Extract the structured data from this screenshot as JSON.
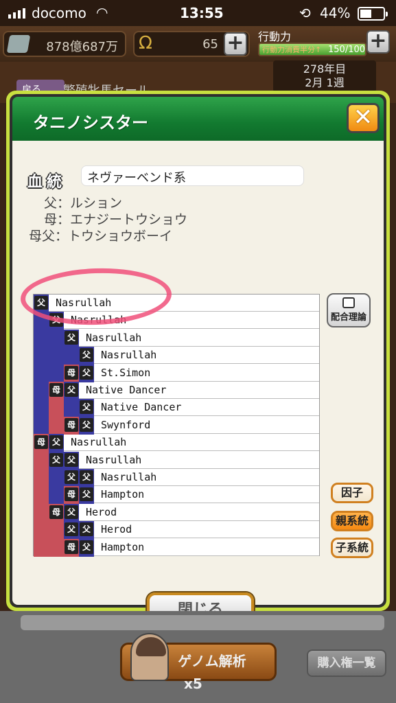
{
  "status": {
    "carrier": "docomo",
    "time": "13:55",
    "battery": "44%"
  },
  "resources": {
    "money": "878億687万",
    "horseshoes": "65",
    "stamina_label": "行動力",
    "stamina_sub": "行動力消費半分↑",
    "stamina_value": "150/100",
    "stamina_fraction": 1.0
  },
  "background": {
    "back_label": "戻る",
    "title": "繁殖牝馬セール",
    "year": "278年目",
    "week": "2月 1週"
  },
  "modal": {
    "title": "タニノシスター",
    "blood_label": "血統",
    "line": "ネヴァーベンド系",
    "sire_key": "父：",
    "sire": "ルション",
    "dam_key": "母：",
    "dam": "エナジートウショウ",
    "damsire_key": "母父：",
    "damsire": "トウショウボーイ",
    "theory_label": "配合理論",
    "factor_label": "因子",
    "parent_line_label": "親系統",
    "child_line_label": "子系統",
    "close_label": "閉じる"
  },
  "pedigree_tags": {
    "sire": "父",
    "dam": "母"
  },
  "pedigree": [
    {
      "name": "Nasrullah"
    },
    {
      "name": "Nasrullah"
    },
    {
      "name": "Nasrullah"
    },
    {
      "name": "Nasrullah"
    },
    {
      "name": "St.Simon"
    },
    {
      "name": "Native Dancer"
    },
    {
      "name": "Native Dancer"
    },
    {
      "name": "Swynford"
    },
    {
      "name": "Nasrullah"
    },
    {
      "name": "Nasrullah"
    },
    {
      "name": "Nasrullah"
    },
    {
      "name": "Hampton"
    },
    {
      "name": "Herod"
    },
    {
      "name": "Herod"
    },
    {
      "name": "Hampton"
    }
  ],
  "bottom": {
    "genome_label": "ゲノム解析",
    "genome_cost": "x5",
    "buy_list_label": "購入権一覧"
  },
  "colors": {
    "sire": "#3a3aa0",
    "dam": "#c8505a",
    "accent": "#c8e040",
    "header": "#127a30"
  }
}
